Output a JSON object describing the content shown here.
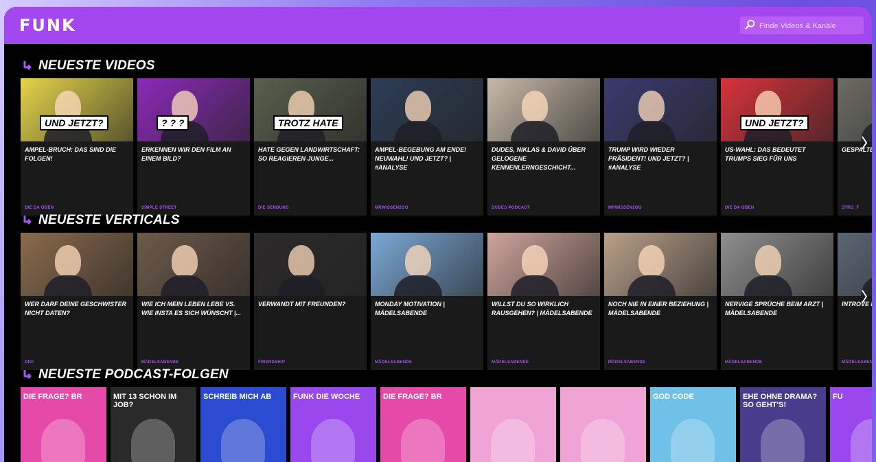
{
  "header": {
    "logo": "FUNK",
    "search_placeholder": "Finde Videos & Kanäle"
  },
  "sections": {
    "videos": {
      "title": "NEUESTE VIDEOS",
      "items": [
        {
          "title": "AMPEL-BRUCH: DAS SIND DIE FOLGEN!",
          "channel": "DIE DA OBEN",
          "overlay": "UND JETZT?",
          "bg": "#e4d44a"
        },
        {
          "title": "ERKENNEN WIR DEN FILM AN EINEM BILD?",
          "channel": "SIMPLE STREET",
          "overlay": "? ? ?",
          "bg": "#8c2ab8"
        },
        {
          "title": "HATE GEGEN LANDWIRTSCHAFT: SO REAGIEREN JUNGE...",
          "channel": "DIE SENDUNG",
          "overlay": "TROTZ HATE",
          "bg": "#5a5f4c"
        },
        {
          "title": "AMPEL-BEGEBUNG AM ENDE! NEUWAHL! UND JETZT? | #ANALYSE",
          "channel": "MRWISSEN2GO",
          "overlay": "",
          "bg": "#2c3d55"
        },
        {
          "title": "DUDES, NIKLAS & DAVID ÜBER GELOGENE KENNENLERNGESCHICHT...",
          "channel": "DUDES PODCAST",
          "overlay": "",
          "bg": "#c7b9a8"
        },
        {
          "title": "TRUMP WIRD WIEDER PRÄSIDENT! UND JETZT? | #ANALYSE",
          "channel": "MRWISSEN2GO",
          "overlay": "",
          "bg": "#3b3a6e"
        },
        {
          "title": "US-WAHL: DAS BEDEUTET TRUMPS SIEG FÜR UNS",
          "channel": "DIE DA OBEN",
          "overlay": "UND JETZT?",
          "bg": "#d8323c"
        },
        {
          "title": "GESPALTEN BEWAFFN ANTIFASC",
          "channel": "STRG_F",
          "overlay": "",
          "bg": "#6c6c64"
        }
      ]
    },
    "verticals": {
      "title": "NEUESTE VERTICALS",
      "items": [
        {
          "title": "WER DARF DEINE GESCHWISTER NICHT DATEN?",
          "channel": "DIDI",
          "bg": "#8b6b4d"
        },
        {
          "title": "WIE ICH MEIN LEBEN LEBE VS. WIE INSTA ES SICH WÜNSCHT |...",
          "channel": "MÄDELSABENDE",
          "bg": "#6e5a4a"
        },
        {
          "title": "VERWANDT MIT FREUNDEN?",
          "channel": "FRIENDSHIP",
          "bg": "#2c2a2a"
        },
        {
          "title": "MONDAY MOTIVATION | MÄDELSABENDE",
          "channel": "MÄDELSABENDE",
          "bg": "#7ba8d6"
        },
        {
          "title": "WILLST DU SO WIRKLICH RAUSGEHEN? | MÄDELSABENDE",
          "channel": "MÄDELSABENDE",
          "bg": "#cfa49c"
        },
        {
          "title": "NOCH NIE IN EINER BEZIEHUNG | MÄDELSABENDE",
          "channel": "MÄDELSABENDE",
          "bg": "#b9a08a"
        },
        {
          "title": "NERVIGE SPRÜCHE BEIM ARZT | MÄDELSABENDE",
          "channel": "MÄDELSABENDE",
          "bg": "#8e8e8e"
        },
        {
          "title": "INTROVE PARTY |",
          "channel": "MÄDELSABENDE",
          "bg": "#5b6574"
        }
      ]
    },
    "podcasts": {
      "title": "NEUESTE PODCAST-FOLGEN",
      "items": [
        {
          "label": "DIE FRAGE? BR",
          "bg": "#e64aa8"
        },
        {
          "label": "MIT 13 SCHON IM JOB?",
          "bg": "#2a2a2a"
        },
        {
          "label": "SCHREIB MICH AB",
          "bg": "#2b4bd0"
        },
        {
          "label": "FUNK DIE WOCHE",
          "bg": "#9a48ee"
        },
        {
          "label": "DIE FRAGE? BR",
          "bg": "#e64aa8"
        },
        {
          "label": "",
          "bg": "#f0a4d6"
        },
        {
          "label": "",
          "bg": "#f0a4d6"
        },
        {
          "label": "GOD CODE",
          "bg": "#6fc1e8"
        },
        {
          "label": "EHE OHNE DRAMA? SO GEHT'S!",
          "bg": "#4a3c8c"
        },
        {
          "label": "FU",
          "bg": "#9a48ee"
        }
      ]
    }
  }
}
